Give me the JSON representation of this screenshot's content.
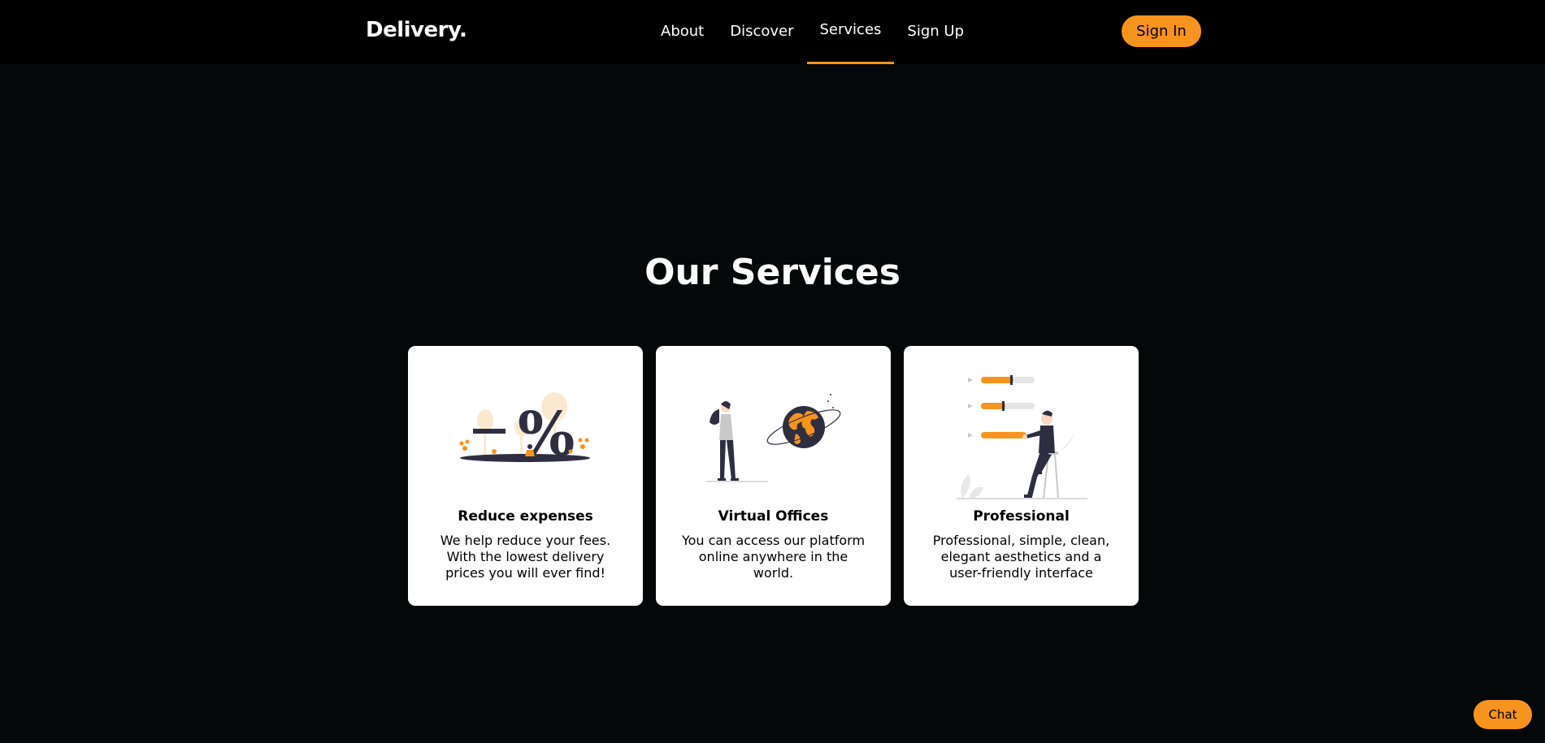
{
  "header": {
    "logo": "Delivery.",
    "nav": [
      {
        "label": "About",
        "active": false
      },
      {
        "label": "Discover",
        "active": false
      },
      {
        "label": "Services",
        "active": true
      },
      {
        "label": "Sign Up",
        "active": false
      }
    ],
    "signin_label": "Sign In"
  },
  "services": {
    "title": "Our Services",
    "cards": [
      {
        "title": "Reduce expenses",
        "text": "We help reduce your fees. With the lowest delivery prices you will ever find!",
        "illustration": "discount-percent-illustration"
      },
      {
        "title": "Virtual Offices",
        "text": "You can access our platform online anywhere in the world.",
        "illustration": "globe-person-illustration"
      },
      {
        "title": "Professional",
        "text": "Professional, simple, clean, elegant aesthetics and a user-friendly interface",
        "illustration": "sliders-person-illustration"
      }
    ]
  },
  "chat": {
    "label": "Chat"
  },
  "colors": {
    "accent": "#f7941d",
    "background": "#040808",
    "navbar": "#000000",
    "card": "#ffffff",
    "illustration_dark": "#2f2e41"
  }
}
